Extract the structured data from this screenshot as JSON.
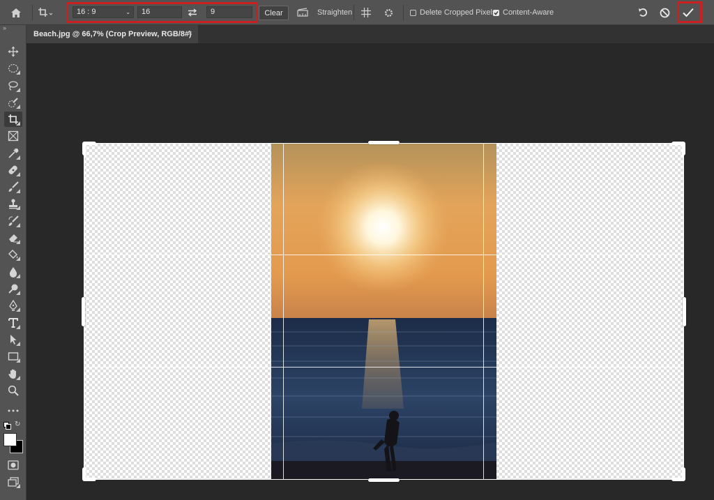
{
  "options_bar": {
    "ratio_preset": "16 : 9",
    "width_value": "16",
    "height_value": "9",
    "clear_label": "Clear",
    "straighten_label": "Straighten",
    "delete_cropped_label": "Delete Cropped Pixels",
    "delete_cropped_checked": false,
    "content_aware_label": "Content-Aware",
    "content_aware_checked": true
  },
  "document_tab": {
    "title": "Beach.jpg @ 66,7% (Crop Preview, RGB/8#)",
    "close_glyph": "×"
  },
  "tools": [
    "move",
    "marquee",
    "lasso",
    "quick-selection",
    "crop",
    "frame",
    "eyedropper",
    "healing-brush",
    "brush",
    "clone-stamp",
    "history-brush",
    "eraser",
    "paint-bucket",
    "blur",
    "dodge",
    "pen",
    "type",
    "path-selection",
    "rectangle",
    "hand",
    "zoom",
    "more"
  ],
  "active_tool": "crop",
  "colors": {
    "foreground": "#ffffff",
    "background": "#000000",
    "highlight": "#cc1f1f"
  }
}
